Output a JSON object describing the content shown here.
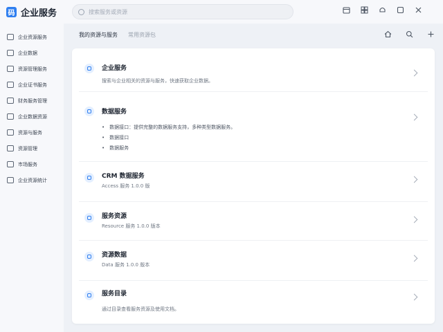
{
  "app": {
    "logo_glyph": "码",
    "title": "企业服务"
  },
  "search": {
    "placeholder": "搜索服务或资源"
  },
  "top_icons": [
    "calendar-icon",
    "grid-icon",
    "bell-icon",
    "window-icon",
    "close-icon"
  ],
  "sidebar": {
    "items": [
      {
        "label": "企业资源服务",
        "icon": "db-icon"
      },
      {
        "label": "企业数据",
        "icon": "doc-icon"
      },
      {
        "label": "资源管理服务",
        "icon": "box-icon"
      },
      {
        "label": "企业证书服务",
        "icon": "cert-icon"
      },
      {
        "label": "财务服务管理",
        "icon": "chart-icon"
      },
      {
        "label": "企业数据资源",
        "icon": "db-icon"
      },
      {
        "label": "资源与服务",
        "icon": "link-icon"
      },
      {
        "label": "资源管理",
        "icon": "folder-icon"
      },
      {
        "label": "市场服务",
        "icon": "market-icon"
      },
      {
        "label": "企业资源统计",
        "icon": "stats-icon"
      }
    ]
  },
  "main": {
    "tabs": [
      {
        "label": "我的资源与服务"
      },
      {
        "label": "常用资源包"
      }
    ],
    "head_icons": [
      "home-icon",
      "search-icon",
      "add-icon"
    ]
  },
  "rows": [
    {
      "title": "企业服务",
      "desc": "搜索与企业相关的资源与服务，快速获取企业数据。",
      "bullets": []
    },
    {
      "title": "数据服务",
      "desc": "",
      "bullets": [
        "数据接口：提供完整的数据服务支持，多种类型数据服务。",
        "数据接口",
        "数据服务"
      ]
    },
    {
      "title": "CRM 数据服务",
      "desc": "Access 服务 1.0.0 版",
      "bullets": []
    },
    {
      "title": "服务资源",
      "desc": "Resource 服务 1.0.0 版本",
      "bullets": []
    },
    {
      "title": "资源数据",
      "desc": "Data 服务 1.0.0 版本",
      "bullets": []
    },
    {
      "title": "服务目录",
      "desc": "通过目录查看服务资源及使用文档。",
      "bullets": []
    }
  ]
}
